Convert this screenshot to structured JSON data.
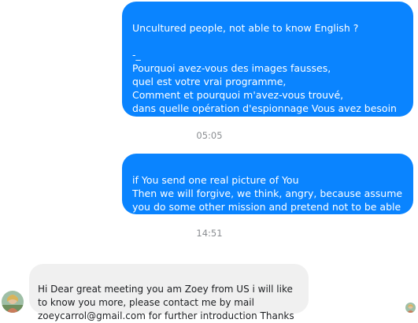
{
  "messages": [
    {
      "direction": "outgoing",
      "text": "Uncultured people, not able to know English ?\n\n-_\nPourquoi avez-vous des images fausses,\nquel est votre vrai programme,\nComment et pourquoi m'avez-vous trouvé,\ndans quelle opération d'espionnage Vous avez besoin d'aide?"
    },
    {
      "direction": "outgoing",
      "text": "if You send one real picture of You\nThen we will forgive, we think, angry, because assume you do some other mission and pretend not to be able to talk english"
    },
    {
      "direction": "incoming",
      "text": "Hi Dear great meeting you am Zoey from US i will like to know you more,  please contact me by mail zoeycarrol@gmail.com for further introduction Thanks"
    }
  ],
  "timestamps": [
    "05:05",
    "14:51"
  ],
  "colors": {
    "outgoing_bubble": "#0a84ff",
    "incoming_bubble": "#f0f0f0",
    "timestamp_text": "#8a8d91"
  },
  "icons": {
    "sender_avatar": "avatar-photo",
    "read_receipt": "seen-avatar-icon"
  }
}
